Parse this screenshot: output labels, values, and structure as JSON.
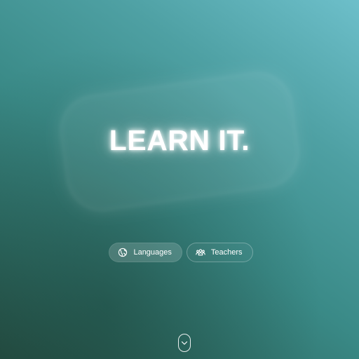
{
  "hero": {
    "title": "LEARN IT."
  },
  "nav": {
    "pills": [
      {
        "label": "Languages",
        "icon": "globe-icon",
        "active": true
      },
      {
        "label": "Teachers",
        "icon": "people-icon",
        "active": false
      }
    ]
  },
  "scroll": {
    "icon": "chevron-down-icon"
  },
  "colors": {
    "background_top_right": "#6dbfca",
    "background_mid": "#3a8a87",
    "background_bottom_left": "#254e43",
    "text": "#ffffff"
  }
}
